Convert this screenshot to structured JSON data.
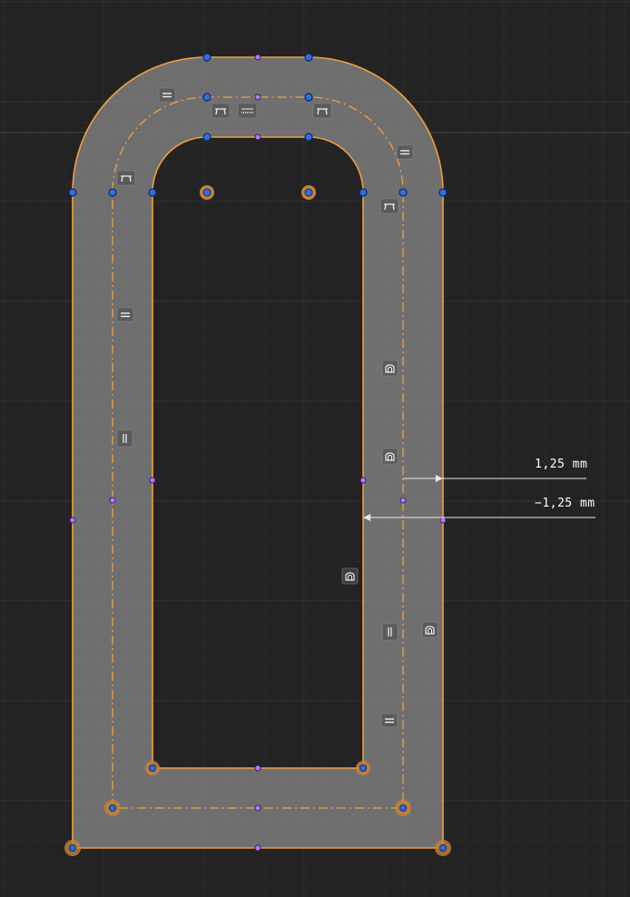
{
  "app": {
    "view": "sketch-canvas",
    "colors": {
      "background": "#232323",
      "grid_minor": "#2e2e2e",
      "grid_major": "#3b3b3b",
      "profile_fill": "#7a7a7a",
      "profile_edge": "#f0a040",
      "construction_line": "#f0a040",
      "vertex_blue": "#2f6fe0",
      "midpoint_purple": "#b07cff",
      "fixed_point_orange": "#c7823a",
      "dimension": "#e8e8e8"
    }
  },
  "dimensions": [
    {
      "id": "offset-outer",
      "value": "1,25 mm"
    },
    {
      "id": "offset-inner",
      "value": "−1,25 mm"
    }
  ],
  "constraint_icons": [
    "horizontal-constraint-icon",
    "tangent-constraint-icon",
    "equal-constraint-icon",
    "parallel-constraint-icon",
    "vertical-constraint-icon",
    "offset-constraint-icon"
  ]
}
